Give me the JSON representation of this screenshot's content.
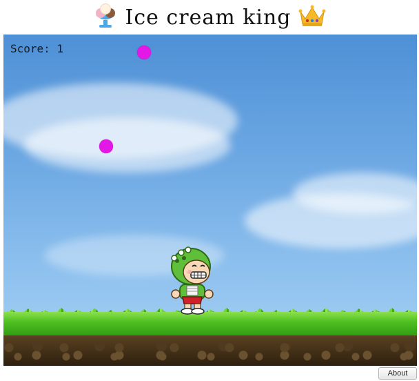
{
  "title": {
    "text": "Ice cream king",
    "left_emoji": "ice-cream-icon",
    "right_emoji": "crown-icon"
  },
  "game": {
    "score_label": "Score: 1",
    "ball_color": "#e317e6",
    "player": "dinosaur-costume-character-sprite"
  },
  "footer": {
    "about_label": "About"
  }
}
